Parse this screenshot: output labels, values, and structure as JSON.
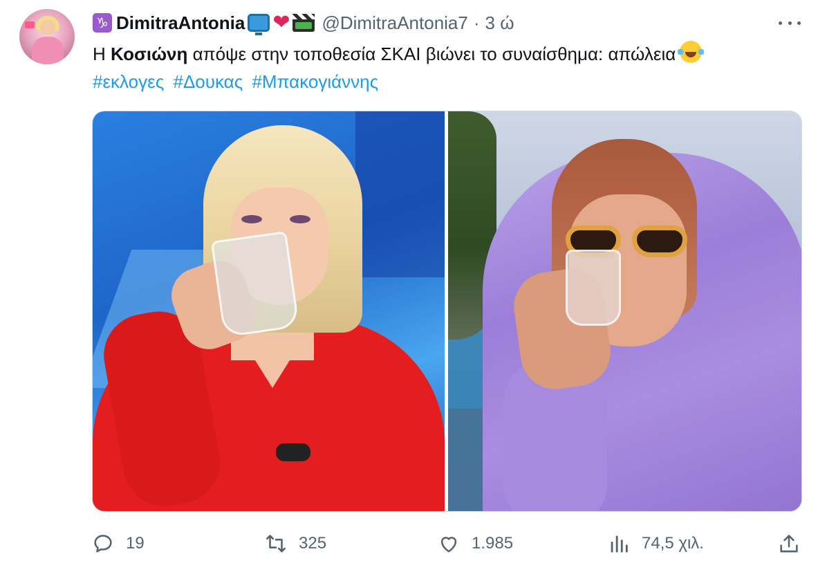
{
  "author": {
    "display_name": "DimitraAntonia",
    "handle": "@DimitraAntonia7",
    "separator": "·",
    "time_ago": "3 ώ",
    "name_prefix_icon": "capricorn-icon",
    "name_suffix_icons": [
      "tv-icon",
      "heart-icon",
      "clapper-board-icon"
    ]
  },
  "tweet": {
    "text_start": "Η ",
    "text_bold": "Κοσιώνη",
    "text_rest": " απόψε στην τοποθεσία ΣΚΑΙ βιώνει το συναίσθημα: απώλεια",
    "text_end_icon": "laughing-tears-icon",
    "hashtags": [
      "#εκλογες",
      "#Δουκας",
      "#Μπακογιάννης"
    ]
  },
  "media": {
    "images": [
      "woman-drinking-water-tv-studio",
      "woman-drinking-purple-scarf-sunglasses"
    ]
  },
  "actions": {
    "reply_count": "19",
    "retweet_count": "325",
    "like_count": "1.985",
    "view_count": "74,5 χιλ."
  },
  "colors": {
    "text": "#0f1419",
    "secondary": "#536471",
    "link": "#1d9bf0",
    "border": "#cfd9de"
  }
}
